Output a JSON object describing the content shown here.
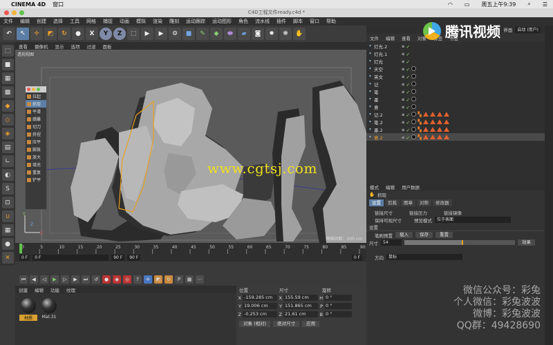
{
  "os": {
    "app_name": "CINEMA 4D",
    "menu_window": "窗口",
    "datetime": "周五上午9:39"
  },
  "window": {
    "title": "C4D工程文件ready.c4d *"
  },
  "menu": [
    "文件",
    "编辑",
    "创建",
    "选择",
    "工具",
    "网格",
    "捕捉",
    "动画",
    "模拟",
    "渲染",
    "雕刻",
    "运动跟踪",
    "运动图形",
    "角色",
    "流水线",
    "插件",
    "脚本",
    "窗口",
    "帮助"
  ],
  "toolbar": {
    "x_label": "X",
    "y_label": "Y",
    "z_label": "Z"
  },
  "viewport": {
    "menu": [
      "查看",
      "摄像机",
      "显示",
      "选项",
      "过滤",
      "面板"
    ],
    "camera_label": "透视视图",
    "grid_label": "网格间距：100 cm",
    "watermark": "www.cgtsj.com"
  },
  "brush_panel": {
    "items": [
      "拉起",
      "抓取",
      "平滑",
      "蜡雕",
      "切刀",
      "挤捏",
      "压平",
      "膨胀",
      "放大",
      "填充",
      "重复",
      "铲平"
    ],
    "selected": "抓取"
  },
  "timeline": {
    "ticks": [
      "0",
      "5",
      "10",
      "15",
      "20",
      "25",
      "30",
      "35",
      "40",
      "45",
      "50",
      "55",
      "60",
      "65",
      "70",
      "75",
      "80",
      "85",
      "90"
    ],
    "start": "0 F",
    "current": "0 F",
    "end_a": "90 F",
    "end_b": "90 F",
    "frame_right": "0 F"
  },
  "materials": {
    "menu": [
      "创建",
      "编辑",
      "功能",
      "纹理"
    ],
    "items": [
      {
        "name": "材质",
        "selected": true
      },
      {
        "name": "Mat.31",
        "selected": false
      }
    ]
  },
  "coordinates": {
    "headers": [
      "位置",
      "尺寸",
      "旋转"
    ],
    "rows": [
      {
        "axis": "X",
        "pos": "-159.285 cm",
        "size_axis": "X",
        "size": "155.59 cm",
        "rot_axis": "H",
        "rot": "0 °"
      },
      {
        "axis": "Y",
        "pos": "19.006 cm",
        "size_axis": "Y",
        "size": "151.865 cm",
        "rot_axis": "P",
        "rot": "0 °"
      },
      {
        "axis": "Z",
        "pos": "-0.253 cm",
        "size_axis": "Z",
        "size": "21.61 cm",
        "rot_axis": "B",
        "rot": "0 °"
      }
    ],
    "mode_a": "对象 (相对)",
    "mode_b": "绝对尺寸",
    "apply": "应用"
  },
  "layout": {
    "label": "界面",
    "value": "启动 (用户)"
  },
  "objects": {
    "menu": [
      "文件",
      "编辑",
      "查看",
      "对象",
      "标签",
      "书签"
    ],
    "rows": [
      {
        "name": "灯光.2",
        "tags": 0,
        "selected": false
      },
      {
        "name": "灯光.1",
        "tags": 0,
        "selected": false
      },
      {
        "name": "灯光",
        "tags": 0,
        "selected": false
      },
      {
        "name": "天空",
        "tags": 1,
        "selected": false
      },
      {
        "name": "英文",
        "tags": 1,
        "selected": false
      },
      {
        "name": "记",
        "tags": 1,
        "selected": false
      },
      {
        "name": "笔",
        "tags": 1,
        "selected": false
      },
      {
        "name": "墨",
        "tags": 1,
        "selected": false
      },
      {
        "name": "意",
        "tags": 1,
        "selected": false
      },
      {
        "name": "记.2",
        "tags": 4,
        "selected": false
      },
      {
        "name": "笔.2",
        "tags": 4,
        "selected": false
      },
      {
        "name": "墨.2",
        "tags": 4,
        "selected": false
      },
      {
        "name": "意.2",
        "tags": 4,
        "selected": true
      }
    ]
  },
  "attributes": {
    "menu": [
      "模式",
      "编辑",
      "用户数据"
    ],
    "tool_name": "抓取",
    "tabs": [
      "设置",
      "剪裁",
      "图章",
      "对称",
      "修改器"
    ],
    "active_tab": "设置",
    "opt1": "链接尺寸",
    "opt2": "链接压力",
    "opt3": "链接镜像",
    "opt4": "保持可视尺寸",
    "opt5": "预览模式",
    "preview_value": "位于表面",
    "section": "设置",
    "preset_label": "笔刷预置",
    "load": "载入",
    "save": "保存",
    "reset": "重置",
    "size_label": "尺寸",
    "size_value": "54",
    "size_fill": 0.52,
    "effect": "效果",
    "direction_label": "方向",
    "direction_value": "鼠标"
  },
  "branding": {
    "tencent": "腾讯视频"
  },
  "overlay_lines": [
    "微信公众号：彩兔",
    "个人微信：彩兔波波",
    "微博：彩兔波波",
    "QQ群：49428690"
  ],
  "colors": {
    "accent": "#5d7fa6",
    "watermark": "#f0e020",
    "selection": "#d8a030"
  }
}
